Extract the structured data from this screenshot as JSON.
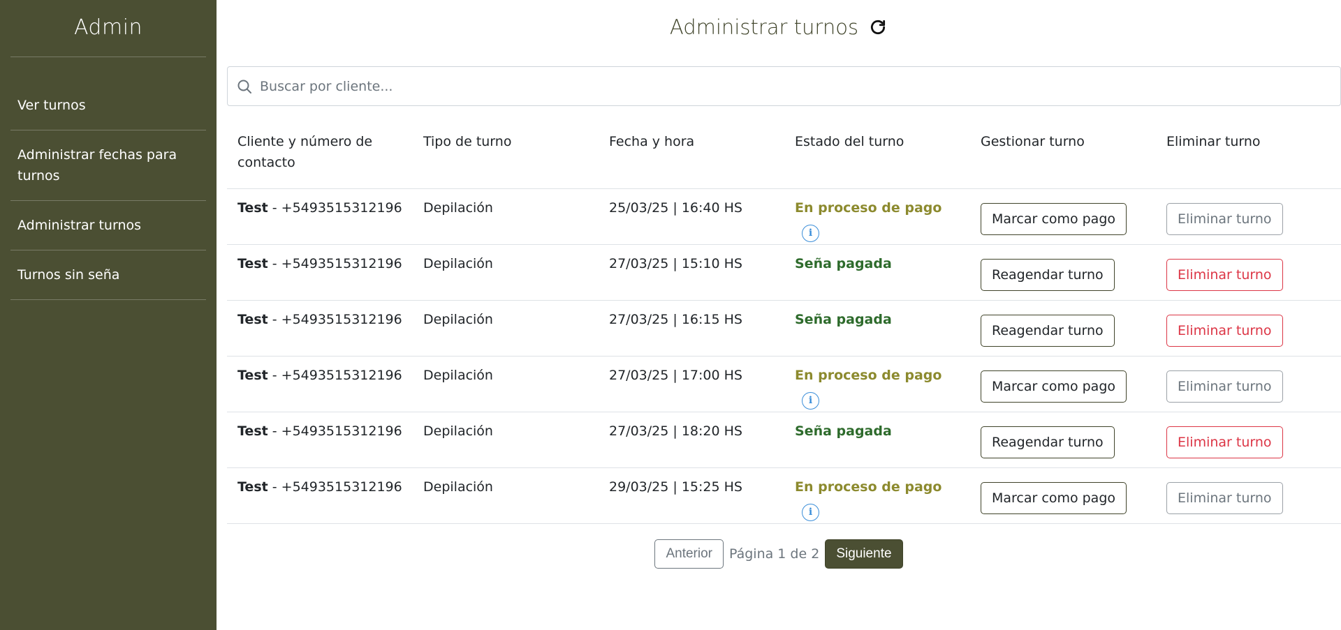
{
  "sidebar": {
    "title": "Admin",
    "items": [
      {
        "label": "Ver turnos"
      },
      {
        "label": "Administrar fechas para turnos"
      },
      {
        "label": "Administrar turnos"
      },
      {
        "label": "Turnos sin seña"
      }
    ],
    "bg_color": "#4b4f33"
  },
  "header": {
    "title": "Administrar turnos",
    "refresh_icon": "refresh-icon"
  },
  "search": {
    "placeholder": "Buscar por cliente...",
    "value": "",
    "icon": "search-icon"
  },
  "table": {
    "columns": [
      "Cliente y número de contacto",
      "Tipo de turno",
      "Fecha y hora",
      "Estado del turno",
      "Gestionar turno",
      "Eliminar turno"
    ],
    "rows": [
      {
        "client": "Test",
        "phone": " - +5493515312196",
        "type": "Depilación",
        "datetime": "25/03/25 | 16:40 HS",
        "state": "En proceso de pago",
        "manage": "Marcar como pago",
        "delete": "Eliminar turno"
      },
      {
        "client": "Test",
        "phone": " - +5493515312196",
        "type": "Depilación",
        "datetime": "27/03/25 | 15:10 HS",
        "state": "Seña pagada",
        "manage": "Reagendar turno",
        "delete": "Eliminar turno"
      },
      {
        "client": "Test",
        "phone": " - +5493515312196",
        "type": "Depilación",
        "datetime": "27/03/25 | 16:15 HS",
        "state": "Seña pagada",
        "manage": "Reagendar turno",
        "delete": "Eliminar turno"
      },
      {
        "client": "Test",
        "phone": " - +5493515312196",
        "type": "Depilación",
        "datetime": "27/03/25 | 17:00 HS",
        "state": "En proceso de pago",
        "manage": "Marcar como pago",
        "delete": "Eliminar turno"
      },
      {
        "client": "Test",
        "phone": " - +5493515312196",
        "type": "Depilación",
        "datetime": "27/03/25 | 18:20 HS",
        "state": "Seña pagada",
        "manage": "Reagendar turno",
        "delete": "Eliminar turno"
      },
      {
        "client": "Test",
        "phone": " - +5493515312196",
        "type": "Depilación",
        "datetime": "29/03/25 | 15:25 HS",
        "state": "En proceso de pago",
        "manage": "Marcar como pago",
        "delete": "Eliminar turno"
      }
    ]
  },
  "pagination": {
    "prev_label": "Anterior",
    "info": "Página 1 de 2",
    "next_label": "Siguiente"
  },
  "colors": {
    "pending": "#8c8a2e",
    "paid": "#2e6b2c",
    "delete_active": "#dc3545",
    "info": "#3b8ed9"
  }
}
